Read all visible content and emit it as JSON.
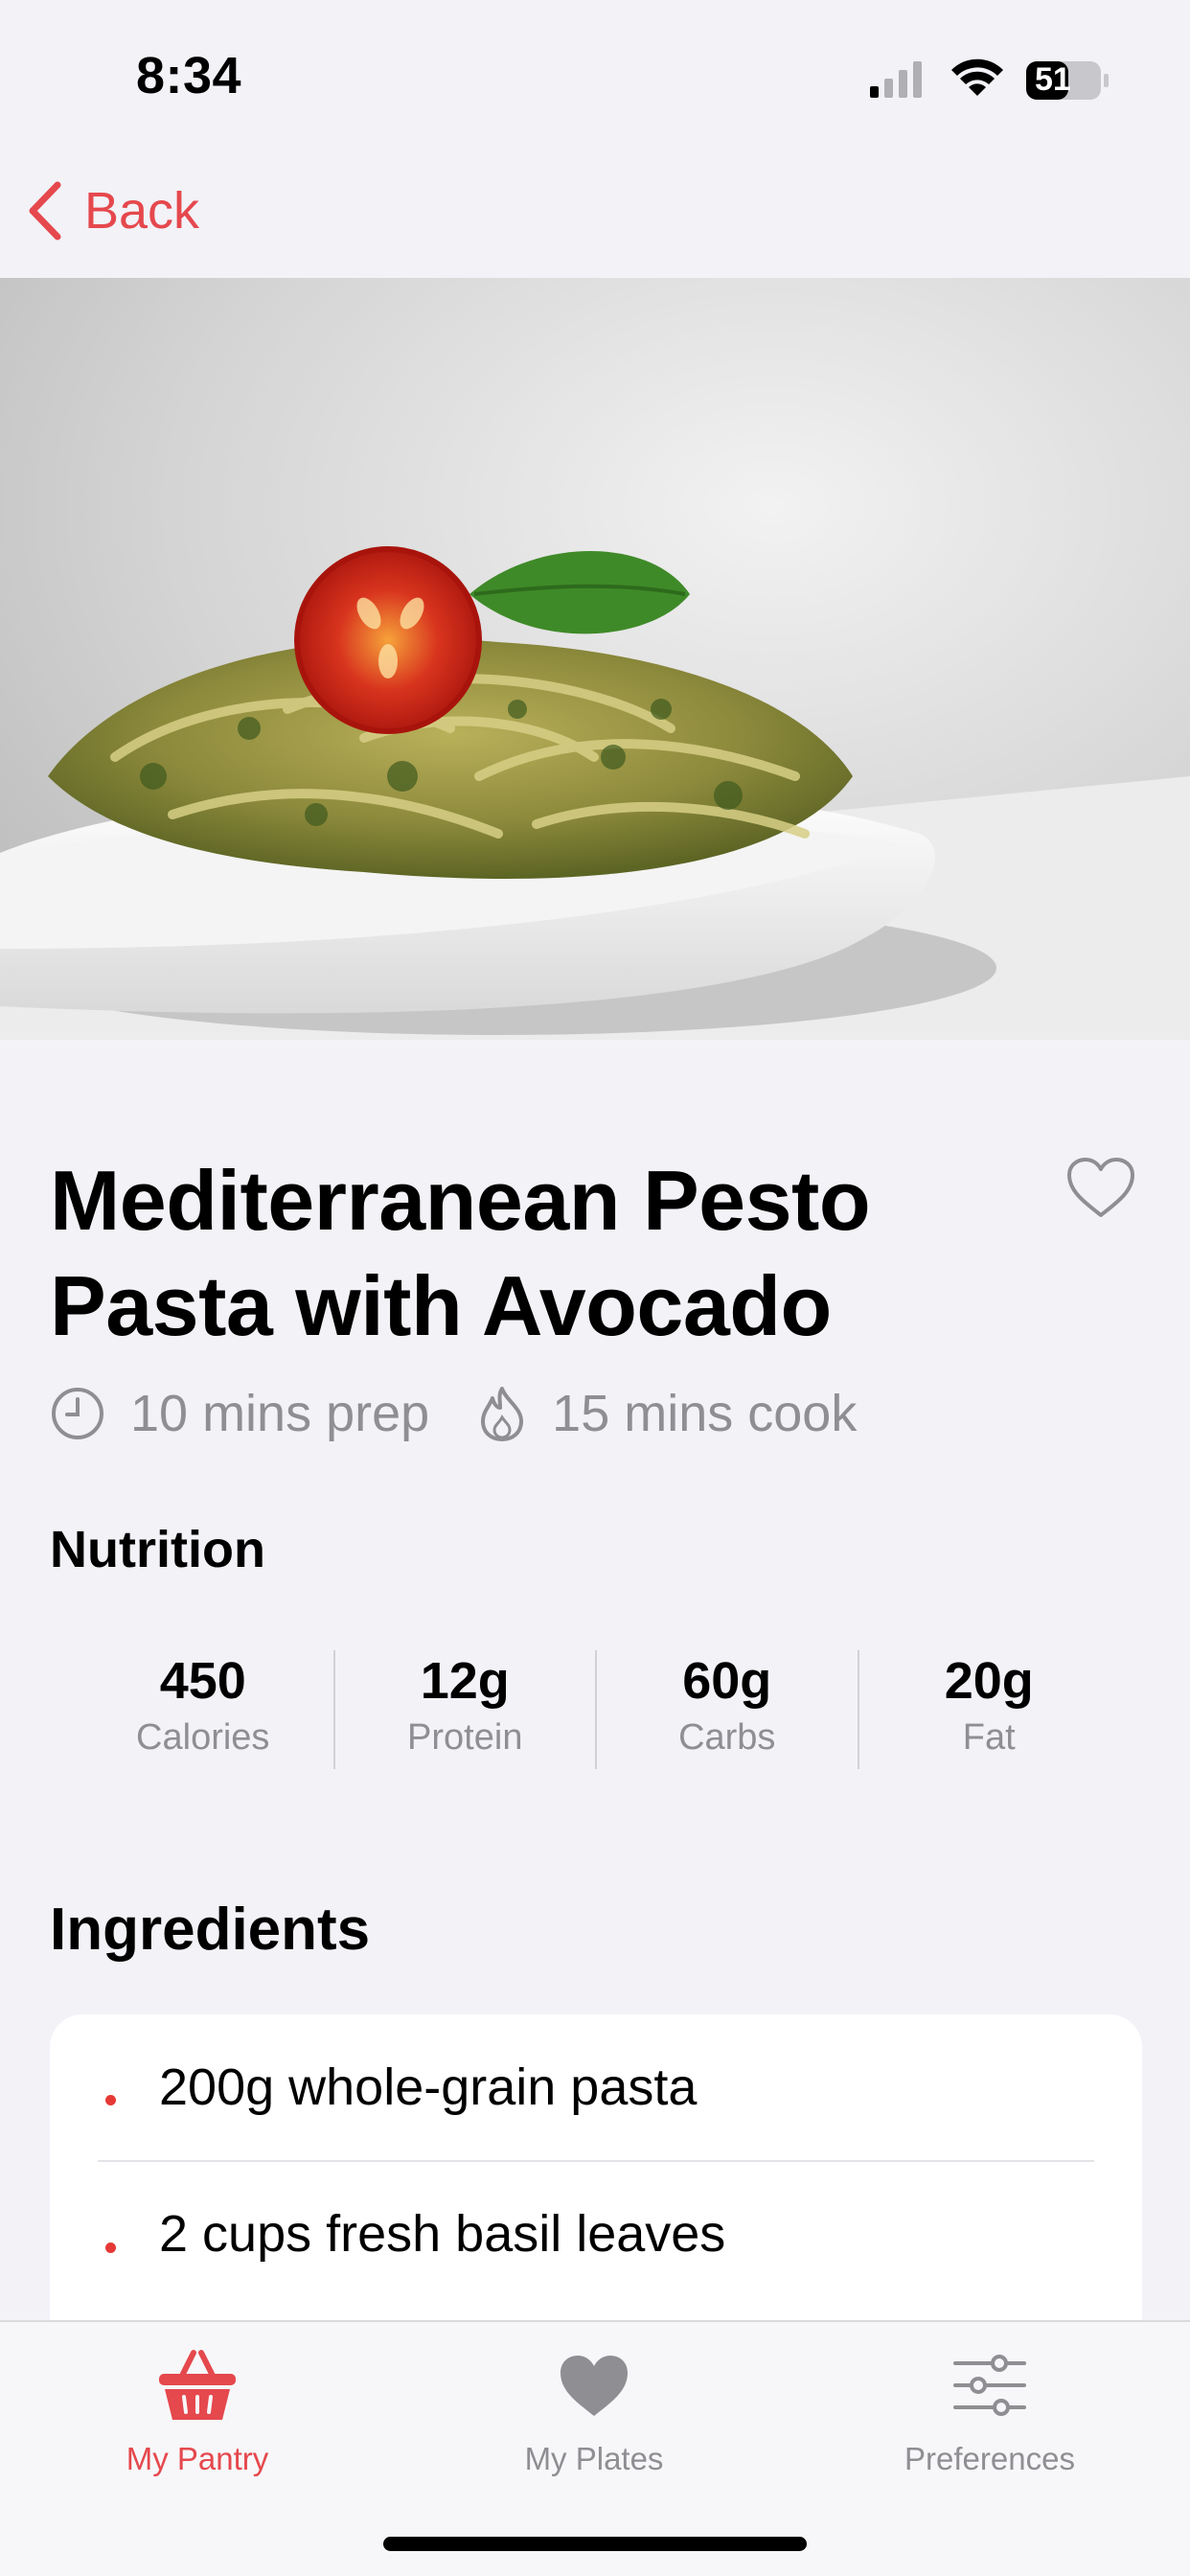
{
  "status_bar": {
    "time": "8:34",
    "battery": "51"
  },
  "nav": {
    "back_label": "Back"
  },
  "recipe": {
    "title_line1": "Mediterranean Pesto",
    "title_line2": "Pasta with Avocado",
    "prep": "10 mins prep",
    "cook": "15 mins cook",
    "favorited": false
  },
  "nutrition": {
    "heading": "Nutrition",
    "items": [
      {
        "value": "450",
        "label": "Calories"
      },
      {
        "value": "12g",
        "label": "Protein"
      },
      {
        "value": "60g",
        "label": "Carbs"
      },
      {
        "value": "20g",
        "label": "Fat"
      }
    ]
  },
  "ingredients": {
    "heading": "Ingredients",
    "items": [
      "200g whole-grain pasta",
      "2 cups fresh basil leaves"
    ]
  },
  "tab_bar": {
    "tabs": [
      {
        "label": "My Pantry",
        "icon": "basket-icon",
        "active": true
      },
      {
        "label": "My Plates",
        "icon": "heart-icon",
        "active": false
      },
      {
        "label": "Preferences",
        "icon": "sliders-icon",
        "active": false
      }
    ]
  },
  "colors": {
    "accent": "#e5484d",
    "inactive": "#8e8e93",
    "background": "#f2f2f7"
  }
}
